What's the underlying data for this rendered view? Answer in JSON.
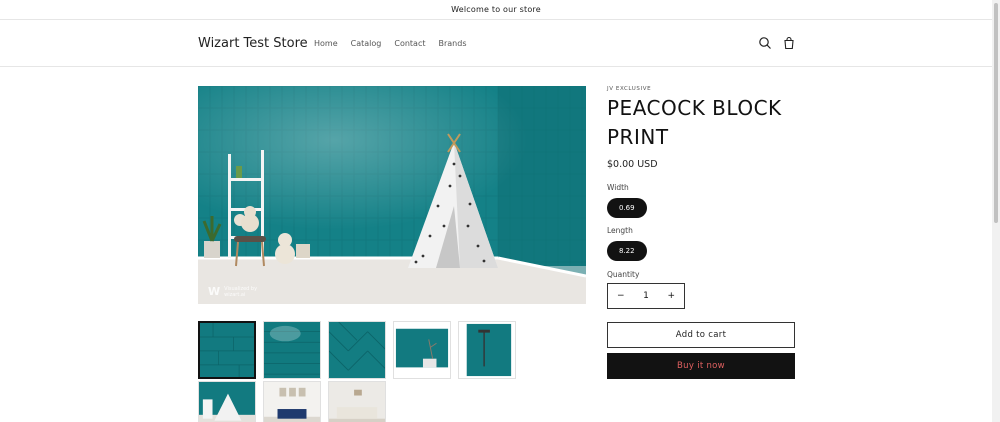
{
  "announcement": "Welcome to our store",
  "header": {
    "logo": "Wizart Test Store",
    "nav": [
      "Home",
      "Catalog",
      "Contact",
      "Brands"
    ],
    "search_icon": "search-icon",
    "cart_icon": "cart-icon"
  },
  "gallery": {
    "watermark_logo": "W",
    "watermark_text_1": "Visualized by",
    "watermark_text_2": "wizart.ai",
    "thumbnail_count": 8,
    "active_thumbnail": 1
  },
  "product": {
    "vendor": "JV EXCLUSIVE",
    "title": "PEACOCK BLOCK PRINT",
    "price": "$0.00 USD",
    "options": [
      {
        "label": "Width",
        "value": "0.69"
      },
      {
        "label": "Length",
        "value": "8.22"
      }
    ],
    "quantity_label": "Quantity",
    "quantity": "1",
    "minus": "−",
    "plus": "+",
    "add_to_cart": "Add to cart",
    "buy_now": "Buy it now"
  },
  "colors": {
    "teal": "#0f7b80",
    "dark": "#121212",
    "buy_text": "#e06060"
  }
}
